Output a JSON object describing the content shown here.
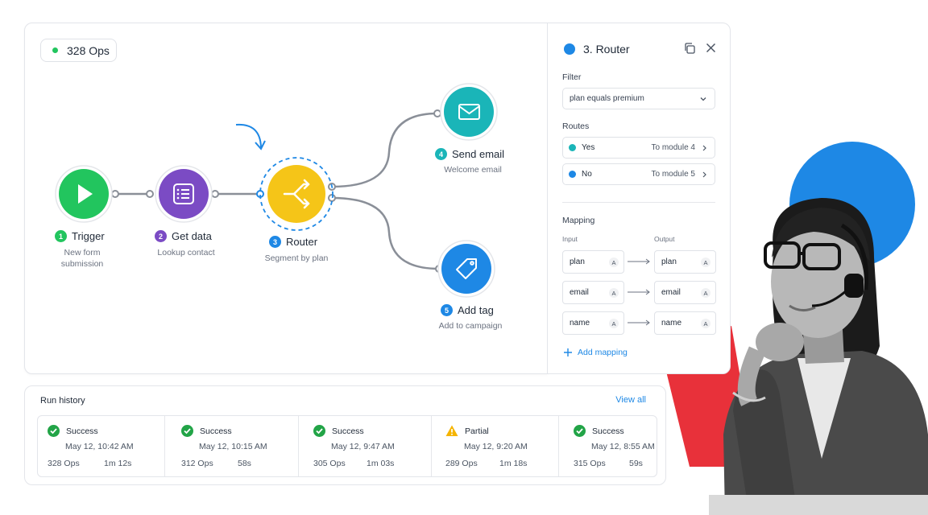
{
  "colors": {
    "accent": "#1e88e5",
    "trigger": "#22c55e",
    "get_data": "#7b4bc4",
    "router": "#f5c518",
    "send_email": "#1ab5b8",
    "add_tag": "#1e88e5",
    "deco_red": "#e8313a",
    "deco_blue": "#1e88e5",
    "partial_warning": "#f5b400"
  },
  "canvas": {
    "ops_count": "328 Ops",
    "nodes": [
      {
        "num": "1",
        "title": "Trigger",
        "subtitle_line1": "New form",
        "subtitle_line2": "submission",
        "icon": "play-icon"
      },
      {
        "num": "2",
        "title": "Get data",
        "subtitle_line1": "Lookup contact",
        "icon": "list-icon"
      },
      {
        "num": "3",
        "title": "Router",
        "subtitle_line1": "Segment by plan",
        "icon": "branch-icon"
      },
      {
        "num": "4",
        "title": "Send email",
        "subtitle_line1": "Welcome email",
        "icon": "mail-icon"
      },
      {
        "num": "5",
        "title": "Add tag",
        "subtitle_line1": "Add to campaign",
        "icon": "tag-icon"
      }
    ]
  },
  "panel": {
    "title": "3. Router",
    "filter_label": "Filter",
    "filter_value": "plan equals premium",
    "routes_label": "Routes",
    "routes": [
      {
        "label": "Yes",
        "destination": "To module 4",
        "color": "#1ab5b8"
      },
      {
        "label": "No",
        "destination": "To module 5",
        "color": "#1e88e5"
      }
    ],
    "mapping_label": "Mapping",
    "input_label": "Input",
    "output_label": "Output",
    "mappings": [
      {
        "input": "plan",
        "output": "plan",
        "type": "A"
      },
      {
        "input": "email",
        "output": "email",
        "type": "A"
      },
      {
        "input": "name",
        "output": "name",
        "type": "A"
      }
    ],
    "add_mapping": "Add mapping"
  },
  "run_history": {
    "title": "Run history",
    "view_all": "View all",
    "runs": [
      {
        "status": "Success",
        "time": "May 12, 10:42 AM",
        "ops": "328 Ops",
        "duration": "1m 12s",
        "icon": "check-circle-icon"
      },
      {
        "status": "Success",
        "time": "May 12, 10:15 AM",
        "ops": "312 Ops",
        "duration": "58s",
        "icon": "check-circle-icon"
      },
      {
        "status": "Success",
        "time": "May 12, 9:47 AM",
        "ops": "305 Ops",
        "duration": "1m 03s",
        "icon": "check-circle-icon"
      },
      {
        "status": "Partial",
        "time": "May 12, 9:20 AM",
        "ops": "289 Ops",
        "duration": "1m 18s",
        "icon": "warning-icon"
      },
      {
        "status": "Success",
        "time": "May 12, 8:55 AM",
        "ops": "315 Ops",
        "duration": "59s",
        "icon": "check-circle-icon"
      }
    ]
  }
}
